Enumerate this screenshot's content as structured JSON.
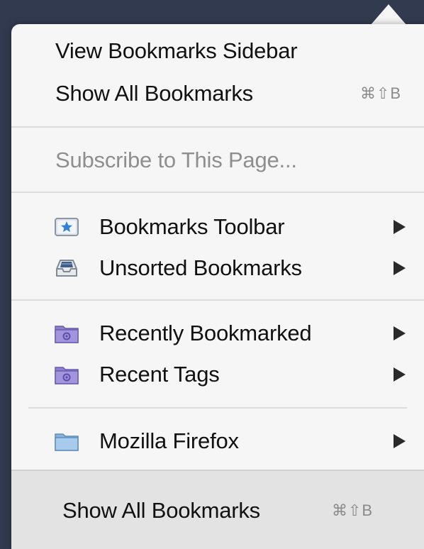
{
  "menu": {
    "view_sidebar": "View Bookmarks Sidebar",
    "show_all": "Show All Bookmarks",
    "show_all_shortcut": "⌘⇧B",
    "subscribe": "Subscribe to This Page...",
    "bookmarks_toolbar": "Bookmarks Toolbar",
    "unsorted": "Unsorted Bookmarks",
    "recently_bookmarked": "Recently Bookmarked",
    "recent_tags": "Recent Tags",
    "mozilla_firefox": "Mozilla Firefox"
  },
  "footer": {
    "label": "Show All Bookmarks",
    "shortcut": "⌘⇧B"
  },
  "icons": {
    "bookmarks_toolbar": "bookmarks-toolbar-star-icon",
    "unsorted": "unsorted-bookmarks-tray-icon",
    "recently_bookmarked": "smart-folder-icon",
    "recent_tags": "smart-folder-icon",
    "mozilla_firefox": "folder-icon"
  },
  "colors": {
    "background": "#313a4f",
    "panel": "#f6f6f6",
    "footer": "#e3e3e3",
    "disabled_text": "#8e8e8e",
    "star_blue": "#2f7fdb",
    "smart_folder_purple": "#8e7fd2",
    "folder_blue": "#9cc3e6"
  }
}
